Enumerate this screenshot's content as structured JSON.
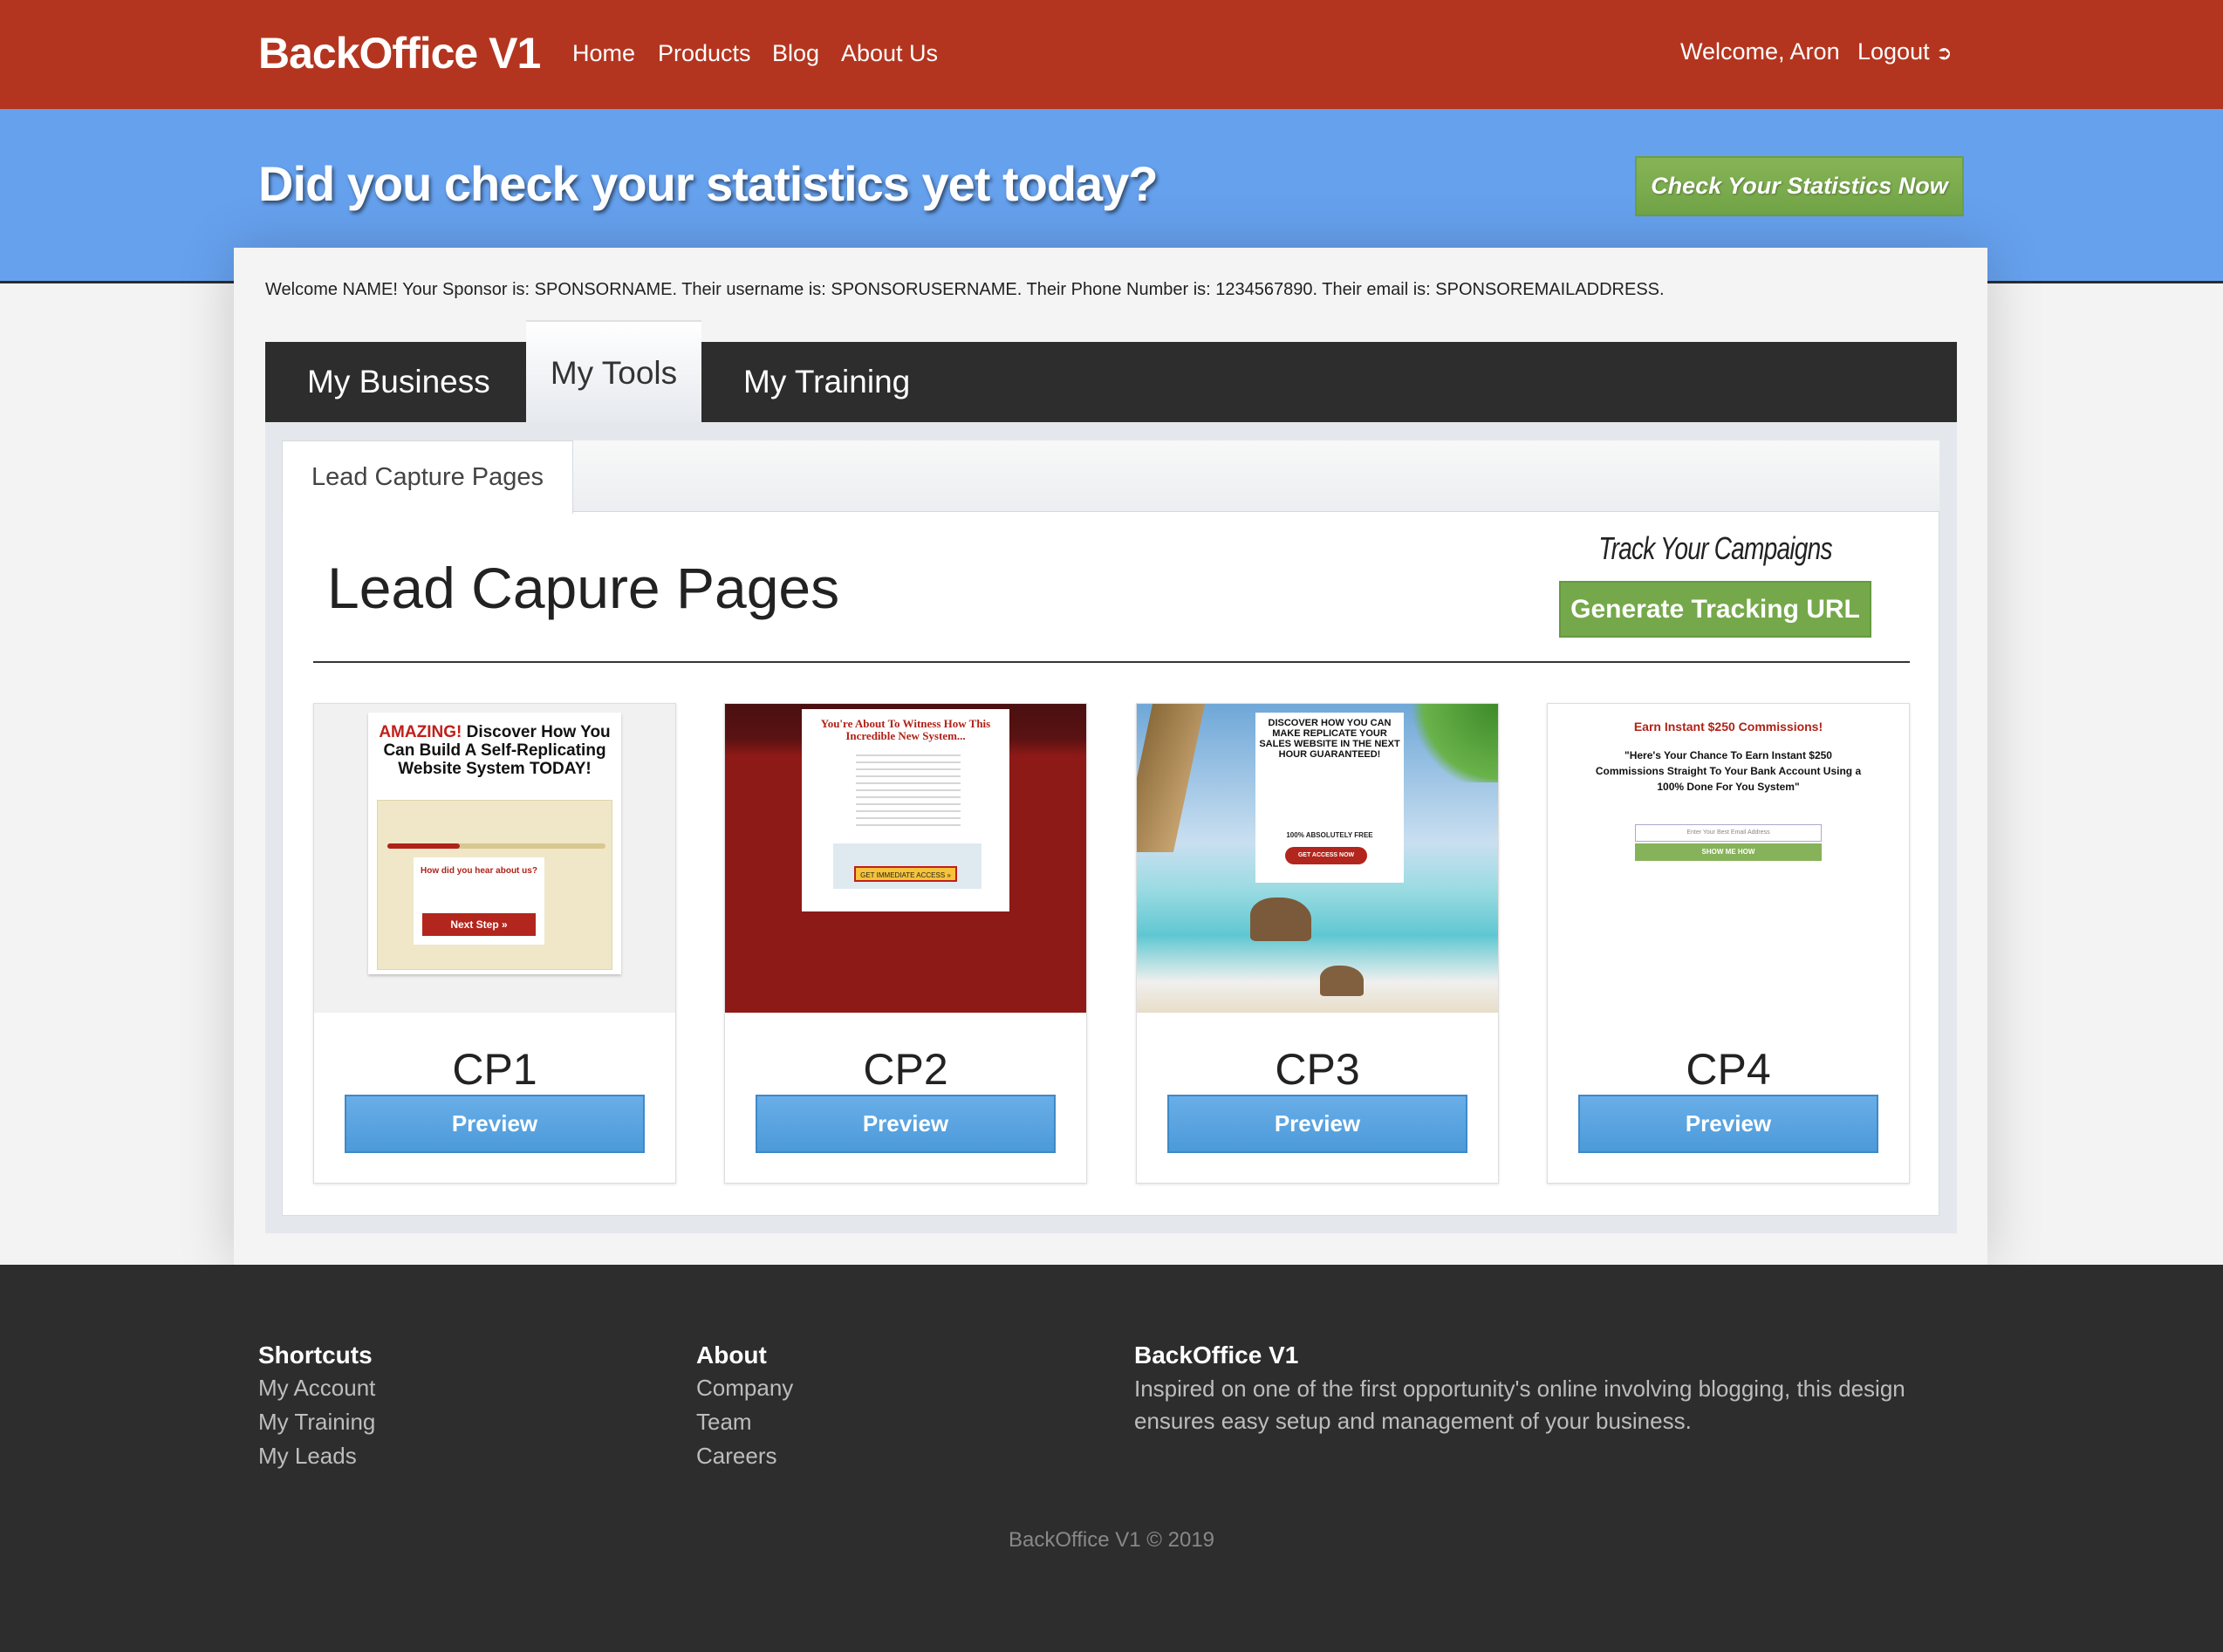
{
  "navbar": {
    "brand": "BackOffice V1",
    "links": [
      "Home",
      "Products",
      "Blog",
      "About Us"
    ],
    "welcome": "Welcome, Aron",
    "logout": "Logout",
    "logout_icon": "sign-out-icon"
  },
  "hero": {
    "headline": "Did you check your statistics yet today?",
    "button": "Check Your Statistics Now"
  },
  "welcome_text": "Welcome NAME! Your Sponsor is: SPONSORNAME. Their username is: SPONSORUSERNAME. Their Phone Number is: 1234567890. Their email is: SPONSOREMAILADDRESS.",
  "tabs": [
    {
      "label": "My Business"
    },
    {
      "label": "My Tools",
      "active": true
    },
    {
      "label": "My Training"
    }
  ],
  "subtab": "Lead Capture Pages",
  "section": {
    "title": "Lead Capure Pages",
    "track_label": "Track Your Campaigns",
    "generate_button": "Generate Tracking URL"
  },
  "cards": [
    {
      "name": "CP1",
      "button": "Preview",
      "thumb": {
        "highlight": "AMAZING!",
        "headline": "Discover How You Can Build A Self-Replicating Website System TODAY!",
        "question": "How did you hear about us?",
        "cta": "Next Step »"
      }
    },
    {
      "name": "CP2",
      "button": "Preview",
      "thumb": {
        "headline": "You're About To Witness How This Incredible New System...",
        "cta": "GET IMMEDIATE ACCESS »"
      }
    },
    {
      "name": "CP3",
      "button": "Preview",
      "thumb": {
        "headline": "DISCOVER HOW YOU CAN MAKE REPLICATE YOUR SALES WEBSITE IN THE NEXT HOUR GUARANTEED!",
        "free": "100% ABSOLUTELY FREE",
        "cta": "GET ACCESS NOW"
      }
    },
    {
      "name": "CP4",
      "button": "Preview",
      "thumb": {
        "headline": "Earn Instant $250 Commissions!",
        "sub": "\"Here's Your Chance To Earn Instant $250 Commissions Straight To Your Bank Account Using a 100% Done For You System\"",
        "placeholder": "Enter Your Best Email Address",
        "cta": "SHOW ME HOW"
      }
    }
  ],
  "footer": {
    "columns": [
      {
        "heading": "Shortcuts",
        "items": [
          "My Account",
          "My Training",
          "My Leads"
        ]
      },
      {
        "heading": "About",
        "items": [
          "Company",
          "Team",
          "Careers"
        ]
      },
      {
        "heading": "BackOffice V1",
        "text": "Inspired on one of the first opportunity's online involving blogging, this design ensures easy setup and management of your business."
      }
    ],
    "copyright": "BackOffice V1 © 2019"
  },
  "colors": {
    "navbar": "#b4351f",
    "hero": "#66a1ee",
    "green": "#75a84a",
    "blue_button": "#5aa4e2",
    "dark": "#2d2d2d"
  }
}
